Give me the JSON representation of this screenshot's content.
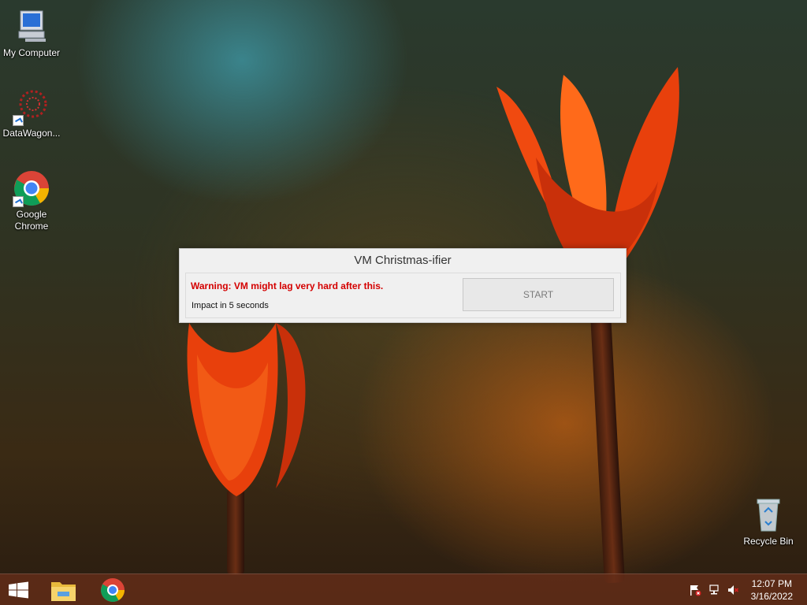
{
  "desktop": {
    "icons": [
      {
        "label": "My Computer",
        "icon": "computer-icon"
      },
      {
        "label": "DataWagon...",
        "icon": "datawagon-icon"
      },
      {
        "label": "Google Chrome",
        "icon": "chrome-icon"
      },
      {
        "label": "Recycle Bin",
        "icon": "recycle-bin-icon"
      }
    ]
  },
  "dialog": {
    "title": "VM Christmas-ifier",
    "warning": "Warning: VM might lag very hard after this.",
    "impact": "Impact in 5 seconds",
    "start_label": "START"
  },
  "taskbar": {
    "items": [
      "windows-start-icon",
      "file-explorer-icon",
      "chrome-icon"
    ],
    "tray": [
      "action-center-flag-icon",
      "network-icon",
      "volume-muted-icon"
    ],
    "time": "12:07 PM",
    "date": "3/16/2022"
  },
  "colors": {
    "warning_text": "#d40000",
    "taskbar": "#642d19",
    "dialog_bg": "#f0f0f0"
  }
}
